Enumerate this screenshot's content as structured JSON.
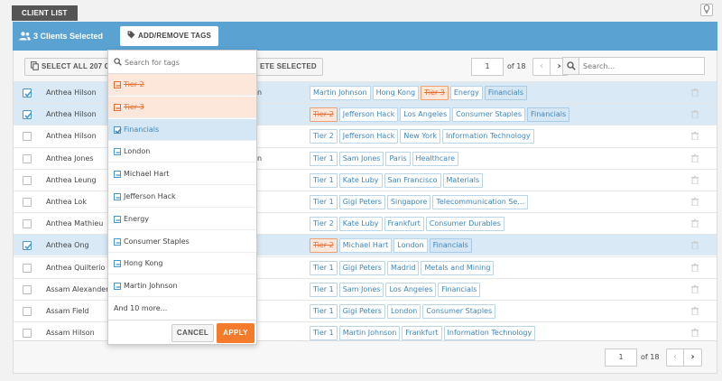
{
  "tab": {
    "label": "CLIENT LIST"
  },
  "icons": {
    "help": "lightbulb-icon",
    "users": "users-icon",
    "tag": "tag-icon",
    "copy": "copy-icon",
    "search": "search-icon",
    "trash": "trash-icon",
    "check": "check-icon",
    "minus": "minus-icon"
  },
  "colors": {
    "selection_bar": "#5aa2d1",
    "selected_row": "#d9eaf6",
    "tag_text": "#3f85bb",
    "removed_tag": "#e86f30",
    "apply_button": "#f47a2c"
  },
  "selection_bar": {
    "count_label": "3 Clients Selected",
    "tags_button": "ADD/REMOVE TAGS"
  },
  "toolbar": {
    "select_all_label": "SELECT ALL 207 C",
    "delete_label": "ETE SELECTED",
    "page_value": "1",
    "page_of": "of 18",
    "search_placeholder": "Search...",
    "prev": "‹",
    "next": "›"
  },
  "rows": [
    {
      "name": "Anthea Hilson",
      "name_ext": "n",
      "selected": true,
      "tags": [
        {
          "text": "Martin Johnson",
          "state": ""
        },
        {
          "text": "Hong Kong",
          "state": ""
        },
        {
          "text": "Tier 3",
          "state": "removed"
        },
        {
          "text": "Energy",
          "state": ""
        },
        {
          "text": "Financials",
          "state": "added"
        }
      ]
    },
    {
      "name": "Anthea Hilson",
      "name_ext": "",
      "selected": true,
      "tags": [
        {
          "text": "Tier 2",
          "state": "removed"
        },
        {
          "text": "Jefferson Hack",
          "state": ""
        },
        {
          "text": "Los Angeles",
          "state": ""
        },
        {
          "text": "Consumer Staples",
          "state": ""
        },
        {
          "text": "Financials",
          "state": "added"
        }
      ]
    },
    {
      "name": "Anthea Hilson",
      "name_ext": "",
      "selected": false,
      "tags": [
        {
          "text": "Tier 2",
          "state": ""
        },
        {
          "text": "Jefferson Hack",
          "state": ""
        },
        {
          "text": "New York",
          "state": ""
        },
        {
          "text": "Information Technology",
          "state": ""
        }
      ]
    },
    {
      "name": "Anthea Jones",
      "name_ext": "n",
      "selected": false,
      "tags": [
        {
          "text": "Tier 1",
          "state": ""
        },
        {
          "text": "Sam Jones",
          "state": ""
        },
        {
          "text": "Paris",
          "state": ""
        },
        {
          "text": "Healthcare",
          "state": ""
        }
      ]
    },
    {
      "name": "Anthea Leung",
      "name_ext": "",
      "selected": false,
      "tags": [
        {
          "text": "Tier 1",
          "state": ""
        },
        {
          "text": "Kate Luby",
          "state": ""
        },
        {
          "text": "San Francisco",
          "state": ""
        },
        {
          "text": "Materials",
          "state": ""
        }
      ]
    },
    {
      "name": "Anthea Lok",
      "name_ext": "",
      "selected": false,
      "tags": [
        {
          "text": "Tier 1",
          "state": ""
        },
        {
          "text": "Gigi Peters",
          "state": ""
        },
        {
          "text": "Singapore",
          "state": ""
        },
        {
          "text": "Telecommunication Se...",
          "state": ""
        }
      ]
    },
    {
      "name": "Anthea Mathieu",
      "name_ext": "",
      "selected": false,
      "tags": [
        {
          "text": "Tier 2",
          "state": ""
        },
        {
          "text": "Kate Luby",
          "state": ""
        },
        {
          "text": "Frankfurt",
          "state": ""
        },
        {
          "text": "Consumer Durables",
          "state": ""
        }
      ]
    },
    {
      "name": "Anthea Ong",
      "name_ext": "",
      "selected": true,
      "tags": [
        {
          "text": "Tier 2",
          "state": "removed"
        },
        {
          "text": "Michael Hart",
          "state": ""
        },
        {
          "text": "London",
          "state": ""
        },
        {
          "text": "Financials",
          "state": "added"
        }
      ]
    },
    {
      "name": "Anthea Quilterio",
      "name_ext": "",
      "selected": false,
      "tags": [
        {
          "text": "Tier 1",
          "state": ""
        },
        {
          "text": "Gigi Peters",
          "state": ""
        },
        {
          "text": "Madrid",
          "state": ""
        },
        {
          "text": "Metals and Mining",
          "state": ""
        }
      ]
    },
    {
      "name": "Assam Alexander",
      "name_ext": "",
      "selected": false,
      "tags": [
        {
          "text": "Tier 1",
          "state": ""
        },
        {
          "text": "Sam Jones",
          "state": ""
        },
        {
          "text": "Los Angeles",
          "state": ""
        },
        {
          "text": "Financials",
          "state": ""
        }
      ]
    },
    {
      "name": "Assam Field",
      "name_ext": "",
      "selected": false,
      "tags": [
        {
          "text": "Tier 1",
          "state": ""
        },
        {
          "text": "Gigi Peters",
          "state": ""
        },
        {
          "text": "London",
          "state": ""
        },
        {
          "text": "Consumer Staples",
          "state": ""
        }
      ]
    },
    {
      "name": "Assam Hilson",
      "name_ext": "",
      "selected": false,
      "tags": [
        {
          "text": "Tier 1",
          "state": ""
        },
        {
          "text": "Martin Johnson",
          "state": ""
        },
        {
          "text": "Frankfurt",
          "state": ""
        },
        {
          "text": "Information Technology",
          "state": ""
        }
      ]
    }
  ],
  "dropdown": {
    "search_placeholder": "Search for tags",
    "items": [
      {
        "label": "Tier 2",
        "state": "removed"
      },
      {
        "label": "Tier 3",
        "state": "removed"
      },
      {
        "label": "Financials",
        "state": "checked"
      },
      {
        "label": "London",
        "state": "partial"
      },
      {
        "label": "Michael Hart",
        "state": "partial"
      },
      {
        "label": "Jefferson Hack",
        "state": "partial"
      },
      {
        "label": "Energy",
        "state": "partial"
      },
      {
        "label": "Consumer Staples",
        "state": "partial"
      },
      {
        "label": "Hong Kong",
        "state": "partial"
      },
      {
        "label": "Martin Johnson",
        "state": "partial"
      }
    ],
    "more_label": "And 10 more...",
    "cancel_label": "CANCEL",
    "apply_label": "APPLY"
  },
  "footer": {
    "page_value": "1",
    "page_of": "of 18",
    "prev": "‹",
    "next": "›"
  }
}
